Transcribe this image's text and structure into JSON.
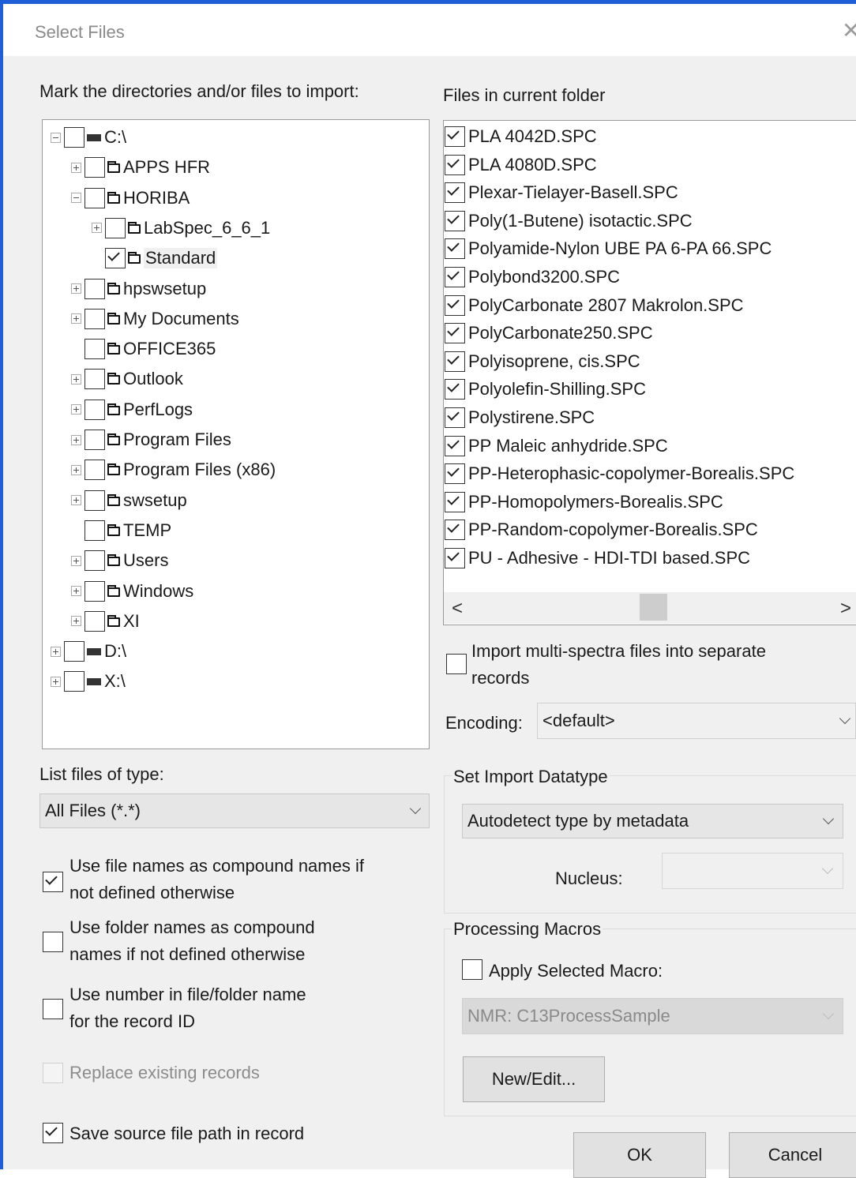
{
  "window": {
    "title": "Select Files",
    "close_glyph": "✕"
  },
  "tree": {
    "heading": "Mark the directories and/or files to import:",
    "items": [
      {
        "label": "C:\\",
        "checked": false
      },
      {
        "label": "APPS HFR",
        "checked": false
      },
      {
        "label": "HORIBA",
        "checked": false
      },
      {
        "label": "LabSpec_6_6_1",
        "checked": false
      },
      {
        "label": "Standard",
        "checked": true
      },
      {
        "label": "hpswsetup",
        "checked": false
      },
      {
        "label": "My Documents",
        "checked": false
      },
      {
        "label": "OFFICE365",
        "checked": false
      },
      {
        "label": "Outlook",
        "checked": false
      },
      {
        "label": "PerfLogs",
        "checked": false
      },
      {
        "label": "Program Files",
        "checked": false
      },
      {
        "label": "Program Files (x86)",
        "checked": false
      },
      {
        "label": "swsetup",
        "checked": false
      },
      {
        "label": "TEMP",
        "checked": false
      },
      {
        "label": "Users",
        "checked": false
      },
      {
        "label": "Windows",
        "checked": false
      },
      {
        "label": "XI",
        "checked": false
      },
      {
        "label": "D:\\",
        "checked": false
      },
      {
        "label": "X:\\",
        "checked": false
      }
    ]
  },
  "files": {
    "heading": "Files in current folder",
    "items": [
      {
        "label": "PLA 4042D.SPC",
        "checked": true
      },
      {
        "label": "PLA 4080D.SPC",
        "checked": true
      },
      {
        "label": "Plexar-Tielayer-Basell.SPC",
        "checked": true
      },
      {
        "label": "Poly(1-Butene) isotactic.SPC",
        "checked": true
      },
      {
        "label": "Polyamide-Nylon UBE PA 6-PA 66.SPC",
        "checked": true
      },
      {
        "label": "Polybond3200.SPC",
        "checked": true
      },
      {
        "label": "PolyCarbonate 2807 Makrolon.SPC",
        "checked": true
      },
      {
        "label": "PolyCarbonate250.SPC",
        "checked": true
      },
      {
        "label": "Polyisoprene, cis.SPC",
        "checked": true
      },
      {
        "label": "Polyolefin-Shilling.SPC",
        "checked": true
      },
      {
        "label": "Polystirene.SPC",
        "checked": true
      },
      {
        "label": "PP Maleic anhydride.SPC",
        "checked": true
      },
      {
        "label": "PP-Heterophasic-copolymer-Borealis.SPC",
        "checked": true
      },
      {
        "label": "PP-Homopolymers-Borealis.SPC",
        "checked": true
      },
      {
        "label": "PP-Random-copolymer-Borealis.SPC",
        "checked": true
      },
      {
        "label": "PU - Adhesive - HDI-TDI based.SPC",
        "checked": true
      }
    ],
    "scroll_left": "<",
    "scroll_right": ">"
  },
  "import_multi": {
    "line1": "Import multi-spectra files into separate",
    "line2": "records",
    "checked": false
  },
  "encoding": {
    "label": "Encoding:",
    "value": "<default>"
  },
  "file_type": {
    "label": "List files of type:",
    "value": "All Files (*.*)"
  },
  "options": {
    "use_file_names": {
      "line1": "Use file names as compound names if",
      "line2": "not defined otherwise",
      "checked": true
    },
    "use_folder_names": {
      "line1": "Use folder names as compound",
      "line2": "names if not defined otherwise",
      "checked": false
    },
    "use_number": {
      "line1": "Use number in file/folder name",
      "line2": "for the record ID",
      "checked": false
    },
    "replace_existing": {
      "label": "Replace existing records",
      "checked": false,
      "disabled": true
    },
    "save_source_path": {
      "label": "Save source file path in record",
      "checked": true
    }
  },
  "datatype": {
    "legend": "Set Import Datatype",
    "value": "Autodetect type by metadata",
    "nucleus_label": "Nucleus:",
    "nucleus_value": ""
  },
  "macros": {
    "legend": "Processing Macros",
    "apply_label": "Apply Selected Macro:",
    "apply_checked": false,
    "macro_value": "NMR: C13ProcessSample",
    "new_edit_label": "New/Edit..."
  },
  "buttons": {
    "ok": "OK",
    "cancel": "Cancel"
  }
}
